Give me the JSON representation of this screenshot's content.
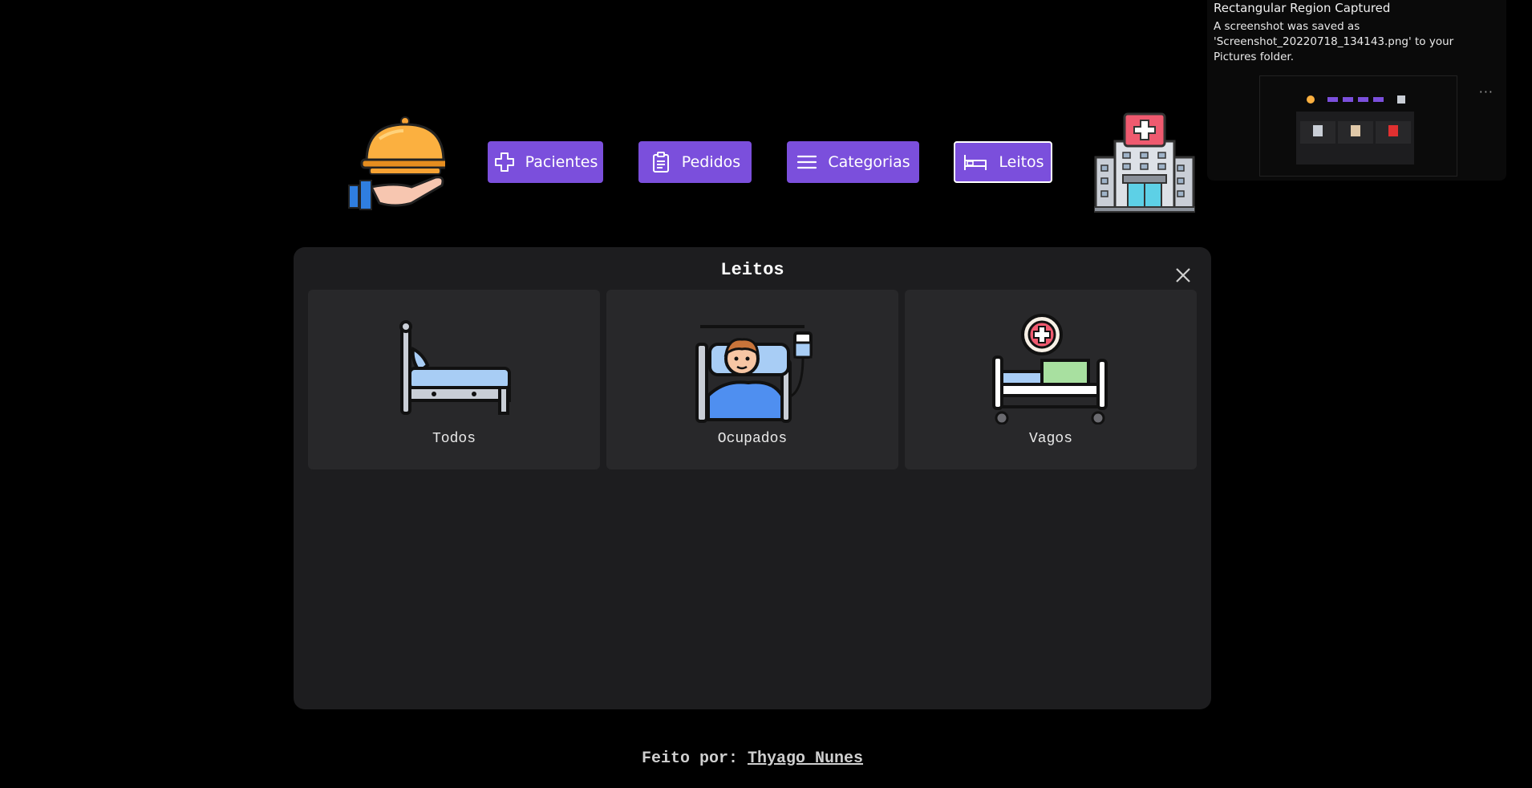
{
  "nav": {
    "pacientes": "Pacientes",
    "pedidos": "Pedidos",
    "categorias": "Categorias",
    "leitos": "Leitos"
  },
  "panel": {
    "title": "Leitos",
    "cards": [
      "Todos",
      "Ocupados",
      "Vagos"
    ]
  },
  "footer": {
    "prefix": "Feito por:",
    "author": "Thyago Nunes"
  },
  "notification": {
    "title": "Rectangular Region Captured",
    "body": "A screenshot was saved as 'Screenshot_20220718_134143.png' to your Pictures folder.",
    "more": "···"
  },
  "colors": {
    "accent": "#7b4fdc",
    "background": "#000000",
    "panel": "#1d1d1f",
    "card": "#28282a"
  }
}
